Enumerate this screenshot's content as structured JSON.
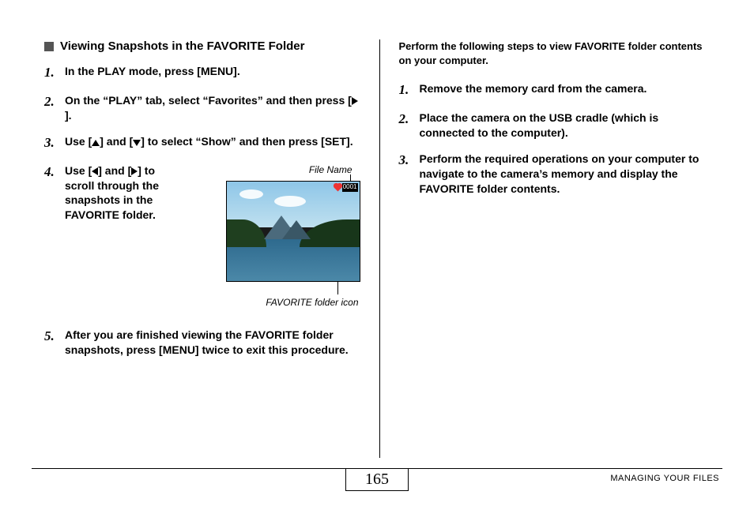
{
  "left": {
    "section_title": "Viewing Snapshots in the FAVORITE Folder",
    "steps": {
      "s1": "In the PLAY mode, press [MENU].",
      "s2_a": "On the “PLAY” tab, select “Favorites” and then press [",
      "s2_b": "].",
      "s3_a": "Use [",
      "s3_b": "] and [",
      "s3_c": "] to select “Show” and then press [SET].",
      "s4_a": "Use [",
      "s4_b": "] and [",
      "s4_c": "] to scroll through the snapshots in the FAVORITE folder.",
      "s5": "After you are finished viewing the FAVORITE folder snapshots, press [MENU] twice to exit this procedure."
    },
    "fig": {
      "top_label": "File Name",
      "bottom_label": "FAVORITE folder icon",
      "file_number": "0001"
    }
  },
  "right": {
    "intro": "Perform the following steps to view FAVORITE folder contents on your computer.",
    "steps": {
      "r1": "Remove the memory card from the camera.",
      "r2": "Place the camera on the USB cradle (which is connected to the computer).",
      "r3": "Perform the required operations on your computer to navigate to the camera’s memory and display the FAVORITE folder contents."
    }
  },
  "footer": {
    "page_number": "165",
    "section": "MANAGING YOUR FILES"
  }
}
